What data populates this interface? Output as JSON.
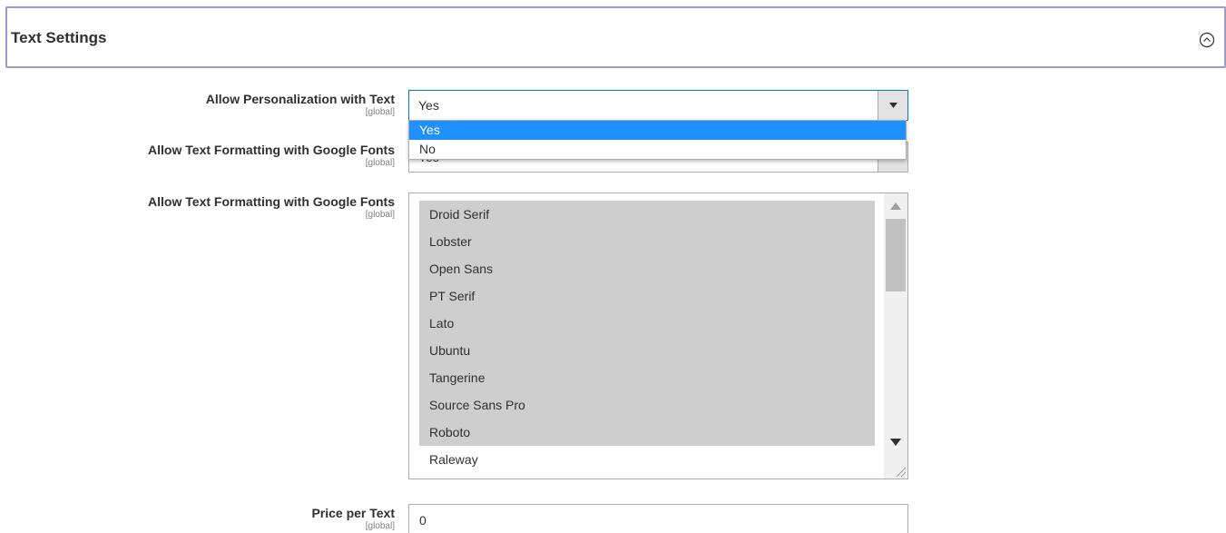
{
  "section": {
    "title": "Text Settings"
  },
  "fields": {
    "allow_personalization": {
      "label": "Allow Personalization with Text",
      "scope": "[global]",
      "value": "Yes",
      "options": [
        "Yes",
        "No"
      ],
      "selected_option": "Yes"
    },
    "allow_google_fonts": {
      "label": "Allow Text Formatting with Google Fonts",
      "scope": "[global]",
      "value": "Yes"
    },
    "google_fonts_list": {
      "label": "Allow Text Formatting with Google Fonts",
      "scope": "[global]",
      "items": [
        {
          "name": "Droid Serif",
          "selected": true
        },
        {
          "name": "Lobster",
          "selected": true
        },
        {
          "name": "Open Sans",
          "selected": true
        },
        {
          "name": "PT Serif",
          "selected": true
        },
        {
          "name": "Lato",
          "selected": true
        },
        {
          "name": "Ubuntu",
          "selected": true
        },
        {
          "name": "Tangerine",
          "selected": true
        },
        {
          "name": "Source Sans Pro",
          "selected": true
        },
        {
          "name": "Roboto",
          "selected": true
        },
        {
          "name": "Raleway",
          "selected": false
        }
      ]
    },
    "price_per_text": {
      "label": "Price per Text",
      "scope": "[global]",
      "value": "0"
    }
  },
  "colors": {
    "header_border": "#9b9bcf",
    "focus_border": "#007bdb",
    "option_highlight": "#1e90ff",
    "multiselect_selected": "#cecece"
  },
  "icons": {
    "collapse": "circle-chevron-up-icon",
    "dropdown": "caret-down-icon"
  }
}
